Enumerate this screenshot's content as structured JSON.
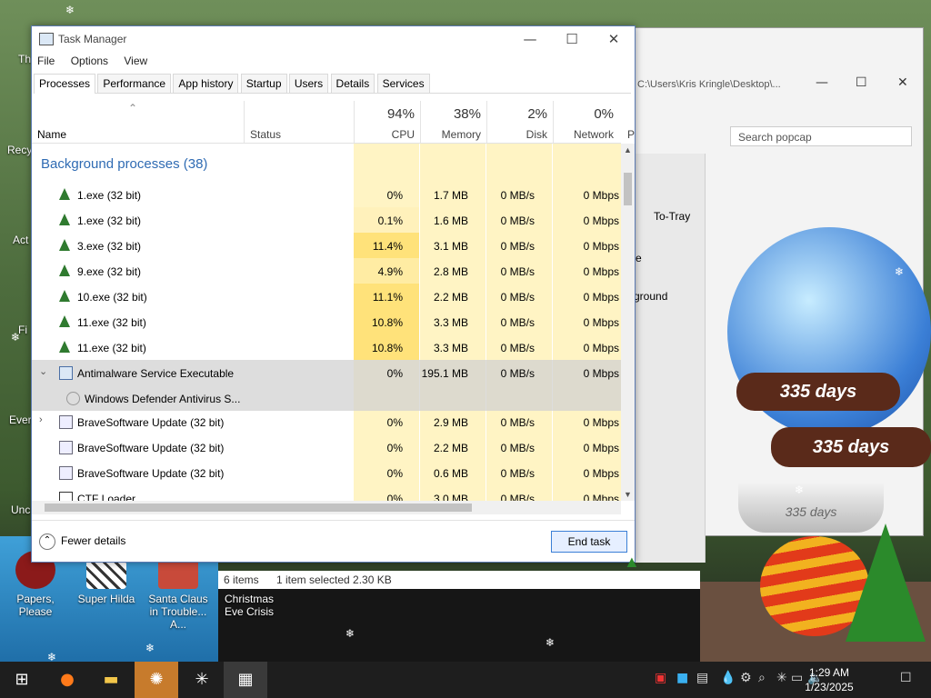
{
  "desktop": {
    "icons": [
      {
        "label": "Papers, Please",
        "icon": "papers-please-icon"
      },
      {
        "label": "Super Hilda",
        "icon": "super-hilda-icon"
      },
      {
        "label": "Santa Claus in Trouble... A...",
        "icon": "santa-claus-icon"
      },
      {
        "label": "Christmas Eve Crisis",
        "icon": "christmas-eve-icon"
      }
    ],
    "edge_labels": [
      "Th",
      "Recy",
      "Act",
      "Fi",
      "Ever",
      "Unc"
    ]
  },
  "background_window": {
    "path": "C:\\Users\\Kris Kringle\\Desktop\\...",
    "search_placeholder": "Search popcap",
    "totray_label": "To-Tray",
    "background_label": "kground",
    "e_label": "e"
  },
  "snow_globe": {
    "band1": "335 days",
    "band2": "335 days",
    "base": "335 days"
  },
  "task_manager": {
    "title": "Task Manager",
    "menu": [
      "File",
      "Options",
      "View"
    ],
    "tabs": [
      "Processes",
      "Performance",
      "App history",
      "Startup",
      "Users",
      "Details",
      "Services"
    ],
    "active_tab": "Processes",
    "columns": {
      "name": "Name",
      "status": "Status",
      "cpu_pct": "94%",
      "cpu": "CPU",
      "mem_pct": "38%",
      "mem": "Memory",
      "disk_pct": "2%",
      "disk": "Disk",
      "net_pct": "0%",
      "net": "Network",
      "power": "P"
    },
    "group_header": "Background processes (38)",
    "rows": [
      {
        "name": "1.exe (32 bit)",
        "cpu": "0%",
        "mem": "1.7 MB",
        "disk": "0 MB/s",
        "net": "0 Mbps",
        "icon": "tree-icon",
        "expand": ""
      },
      {
        "name": "1.exe (32 bit)",
        "cpu": "0.1%",
        "mem": "1.6 MB",
        "disk": "0 MB/s",
        "net": "0 Mbps",
        "icon": "tree-icon",
        "expand": ""
      },
      {
        "name": "3.exe (32 bit)",
        "cpu": "11.4%",
        "mem": "3.1 MB",
        "disk": "0 MB/s",
        "net": "0 Mbps",
        "icon": "tree-icon",
        "expand": ""
      },
      {
        "name": "9.exe (32 bit)",
        "cpu": "4.9%",
        "mem": "2.8 MB",
        "disk": "0 MB/s",
        "net": "0 Mbps",
        "icon": "tree-icon",
        "expand": ""
      },
      {
        "name": "10.exe (32 bit)",
        "cpu": "11.1%",
        "mem": "2.2 MB",
        "disk": "0 MB/s",
        "net": "0 Mbps",
        "icon": "tree-icon",
        "expand": ""
      },
      {
        "name": "11.exe (32 bit)",
        "cpu": "10.8%",
        "mem": "3.3 MB",
        "disk": "0 MB/s",
        "net": "0 Mbps",
        "icon": "tree-icon",
        "expand": ""
      },
      {
        "name": "11.exe (32 bit)",
        "cpu": "10.8%",
        "mem": "3.3 MB",
        "disk": "0 MB/s",
        "net": "0 Mbps",
        "icon": "tree-icon",
        "expand": ""
      },
      {
        "name": "Antimalware Service Executable",
        "cpu": "0%",
        "mem": "195.1 MB",
        "disk": "0 MB/s",
        "net": "0 Mbps",
        "icon": "service-icon",
        "expand": "⌄",
        "selected": true
      },
      {
        "name": "Windows Defender Antivirus S...",
        "cpu": "",
        "mem": "",
        "disk": "",
        "net": "",
        "icon": "gear-icon",
        "expand": "",
        "selected": true,
        "child": true
      },
      {
        "name": "BraveSoftware Update (32 bit)",
        "cpu": "0%",
        "mem": "2.9 MB",
        "disk": "0 MB/s",
        "net": "0 Mbps",
        "icon": "update-icon",
        "expand": "›"
      },
      {
        "name": "BraveSoftware Update (32 bit)",
        "cpu": "0%",
        "mem": "2.2 MB",
        "disk": "0 MB/s",
        "net": "0 Mbps",
        "icon": "update-icon",
        "expand": ""
      },
      {
        "name": "BraveSoftware Update (32 bit)",
        "cpu": "0%",
        "mem": "0.6 MB",
        "disk": "0 MB/s",
        "net": "0 Mbps",
        "icon": "update-icon",
        "expand": ""
      },
      {
        "name": "CTF Loader",
        "cpu": "0%",
        "mem": "3.0 MB",
        "disk": "0 MB/s",
        "net": "0 Mbps",
        "icon": "pen-icon",
        "expand": ""
      }
    ],
    "fewer_details": "Fewer details",
    "end_task": "End task"
  },
  "explorer_status": {
    "items": "6 items",
    "selected": "1 item selected  2.30 KB"
  },
  "taskbar": {
    "clock_time": "1:29 AM",
    "clock_date": "1/23/2025"
  },
  "colors": {
    "accent": "#2f6bb3",
    "cpu_highlight": "#ffe27a",
    "taskbar": "#1e1e1e"
  }
}
